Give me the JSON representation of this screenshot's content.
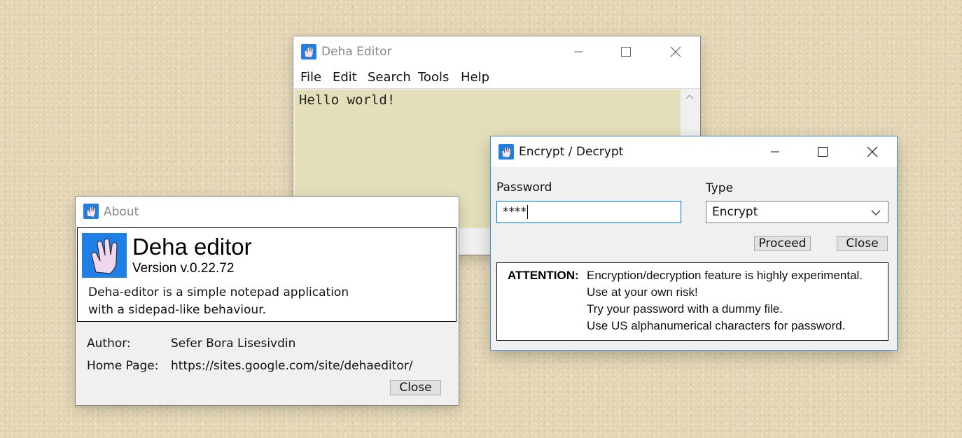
{
  "editor": {
    "title": "Deha Editor",
    "menu": [
      "File",
      "Edit",
      "Search",
      "Tools",
      "Help"
    ],
    "content": "Hello world!"
  },
  "about": {
    "title": "About",
    "app_name": "Deha editor",
    "version": "Version v.0.22.72",
    "description_line1": "Deha-editor is a simple notepad application",
    "description_line2": "with a sidepad-like behaviour.",
    "author_label": "Author:",
    "author_value": "Sefer Bora Lisesivdin",
    "homepage_label": "Home Page:",
    "homepage_value": "https://sites.google.com/site/dehaeditor/",
    "close_label": "Close"
  },
  "encrypt": {
    "title": "Encrypt / Decrypt",
    "password_label": "Password",
    "password_value": "****",
    "type_label": "Type",
    "type_value": "Encrypt",
    "proceed_label": "Proceed",
    "close_label": "Close",
    "attention_label": "ATTENTION:",
    "attention_lines": [
      "Encryption/decryption feature is highly experimental.",
      "Use at your own risk!",
      "Try your password with a dummy file.",
      "Use US alphanumerical characters for password."
    ]
  },
  "colors": {
    "app_icon": "#1e7fe6",
    "editor_bg": "#e3dfba",
    "active_border": "#3a8fd8"
  }
}
